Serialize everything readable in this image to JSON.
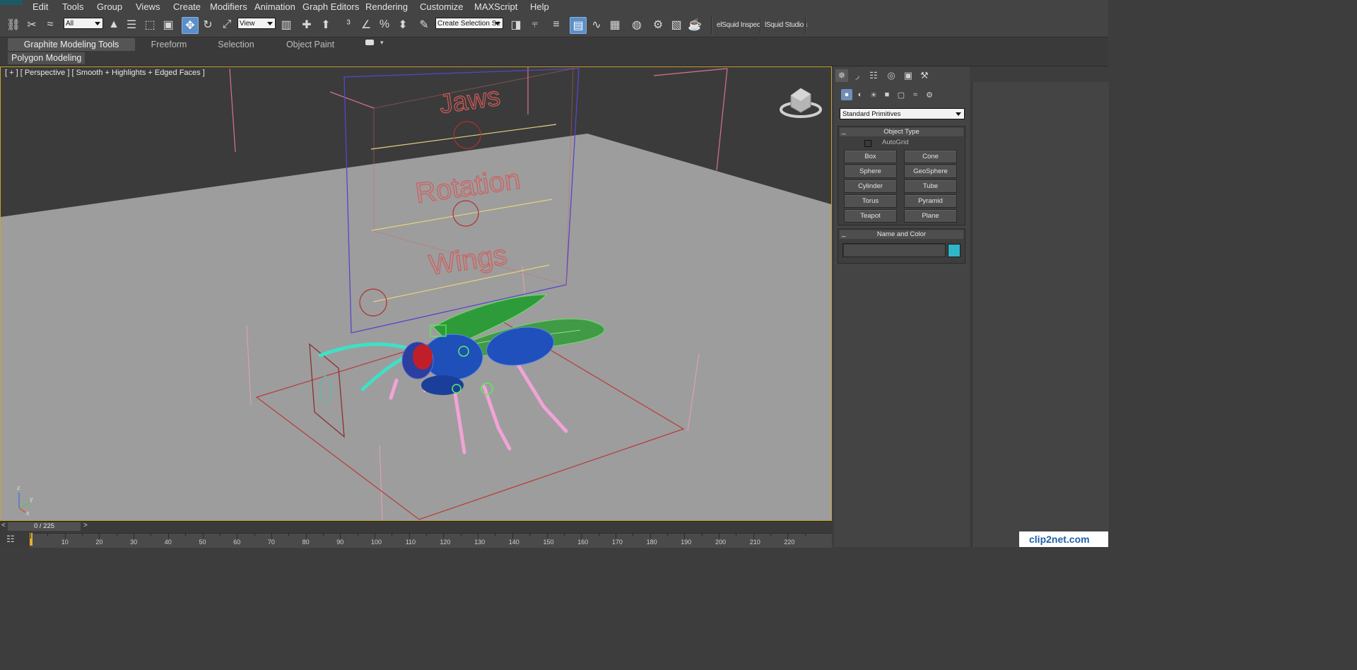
{
  "menu": {
    "items": [
      "Edit",
      "Tools",
      "Group",
      "Views",
      "Create",
      "Modifiers",
      "Animation",
      "Graph Editors",
      "Rendering",
      "Customize",
      "MAXScript",
      "Help"
    ]
  },
  "toolbar": {
    "selection_filter": "All",
    "reference_coord": "View",
    "named_selection": "Create Selection Se",
    "plugin_1": "elSquid Inspec",
    "plugin_2": "lSquid Studio ‹"
  },
  "ribbon": {
    "tabs": [
      "Graphite Modeling Tools",
      "Freeform",
      "Selection",
      "Object Paint"
    ],
    "active_tab": "Graphite Modeling Tools",
    "panel_label": "Polygon Modeling"
  },
  "viewport": {
    "label": "[ + ] [ Perspective ] [ Smooth + Highlights + Edged Faces ]",
    "scene_text": {
      "jaws": "Jaws",
      "rotation": "Rotation",
      "wings": "Wings"
    },
    "gizmo_axes": {
      "z": "z",
      "y": "y",
      "x": "x"
    }
  },
  "command_panel": {
    "category": "Standard Primitives",
    "object_type_title": "Object Type",
    "autogrid_label": "AutoGrid",
    "autogrid_checked": false,
    "primitives": [
      "Box",
      "Cone",
      "Sphere",
      "GeoSphere",
      "Cylinder",
      "Tube",
      "Torus",
      "Pyramid",
      "Teapot",
      "Plane"
    ],
    "name_color_title": "Name and Color",
    "object_name": "",
    "object_color": "#2fb6c9"
  },
  "timeline": {
    "current_frame": "0 / 225",
    "current": 0,
    "total": 225,
    "ticks": [
      "10",
      "20",
      "30",
      "40",
      "50",
      "60",
      "70",
      "80",
      "90",
      "100",
      "110",
      "120",
      "130",
      "140",
      "150",
      "160",
      "170",
      "180",
      "190",
      "200",
      "210",
      "220"
    ]
  },
  "watermark": "clip2net.com"
}
